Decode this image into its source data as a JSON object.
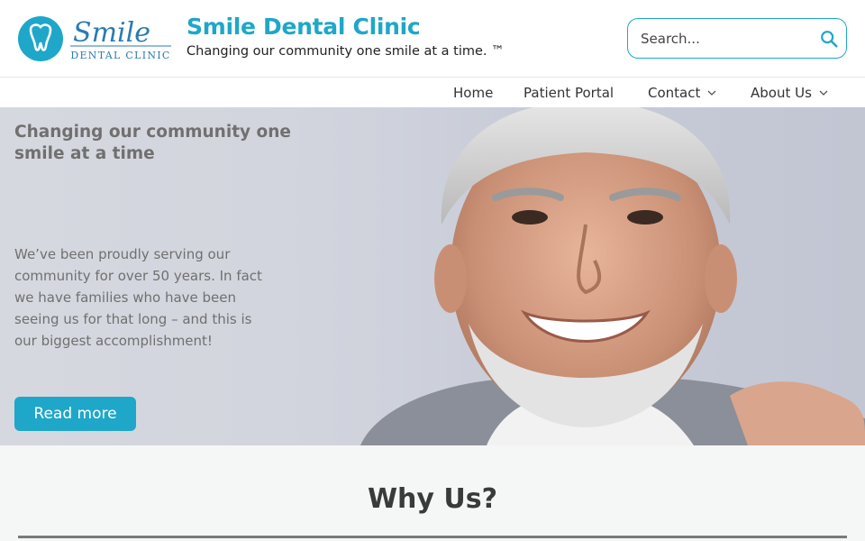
{
  "header": {
    "logo_script": "Smile",
    "logo_sub": "DENTAL CLINIC",
    "site_title": "Smile Dental Clinic",
    "tagline": "Changing our community one smile at a time. ™"
  },
  "search": {
    "placeholder": "Search...",
    "icon": "search-icon"
  },
  "nav": {
    "items": [
      {
        "label": "Home",
        "has_dropdown": false
      },
      {
        "label": "Patient Portal",
        "has_dropdown": false
      },
      {
        "label": "Contact",
        "has_dropdown": true
      },
      {
        "label": "About Us",
        "has_dropdown": true
      }
    ]
  },
  "hero": {
    "heading": "Changing our community one smile at a time",
    "body": "We’ve been proudly serving our community for over 50 years. In fact we have families who have been seeing us for that long – and this is our biggest accomplishment!",
    "button_label": "Read more"
  },
  "why": {
    "title": "Why Us?"
  },
  "colors": {
    "accent": "#1fa7c9",
    "hero_text": "#707070",
    "section_bg": "#f5f6f6"
  }
}
